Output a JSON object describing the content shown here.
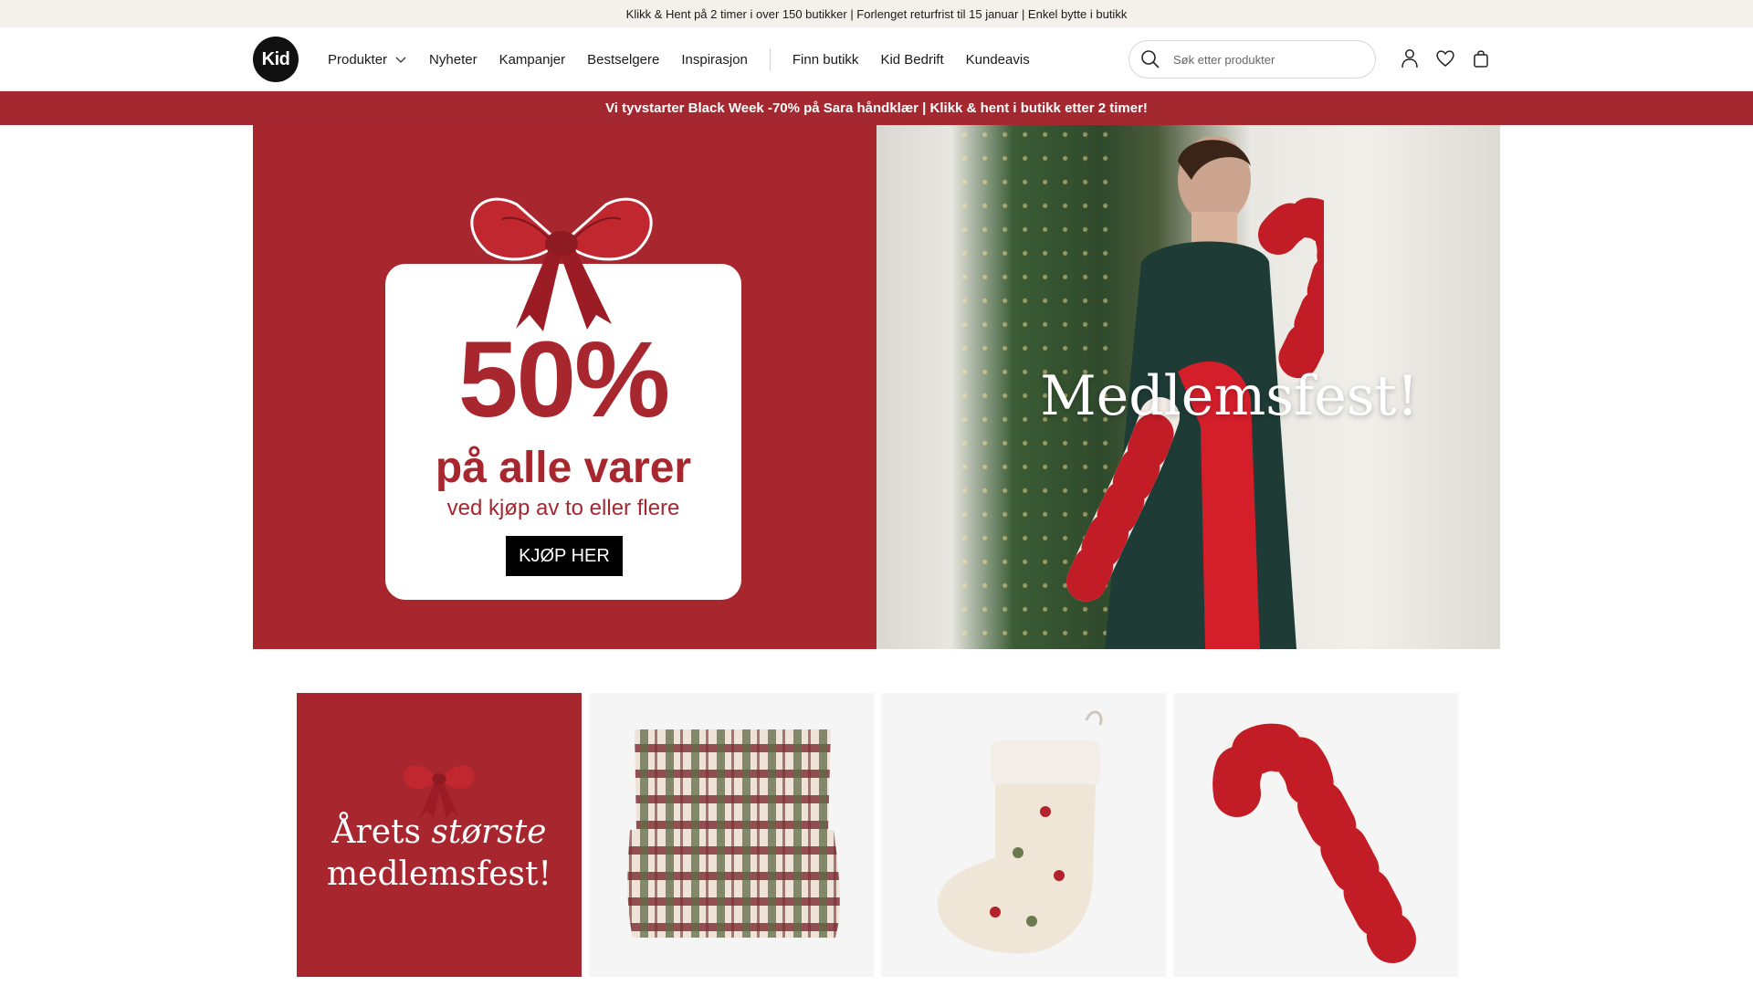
{
  "topbar": {
    "text": "Klikk & Hent på 2 timer i over 150 butikker | Forlenget returfrist til 15 januar | Enkel bytte i butikk"
  },
  "header": {
    "logo": "Kid",
    "nav": {
      "products": "Produkter",
      "news": "Nyheter",
      "campaigns": "Kampanjer",
      "bestsellers": "Bestselgere",
      "inspiration": "Inspirasjon",
      "find_store": "Finn butikk",
      "business": "Kid Bedrift",
      "newspaper": "Kundeavis"
    },
    "search": {
      "placeholder": "Søk etter produkter"
    }
  },
  "promo": {
    "text": "Vi tyvstarter Black Week -70% på Sara håndklær | Klikk & hent i butikk etter 2 timer!"
  },
  "hero": {
    "left": {
      "percent": "50%",
      "line1": "på alle varer",
      "line2": "ved kjøp av to eller flere",
      "cta": "KJØP HER"
    },
    "right": {
      "title": "Medlemsfest!"
    }
  },
  "tiles": {
    "red": {
      "line1_a": "Årets ",
      "line1_b": "største",
      "line2": "medlemsfest!"
    }
  },
  "colors": {
    "brand_red": "#a8262e",
    "topbar_bg": "#f4f1ea",
    "promo_red": "#a3282f"
  }
}
